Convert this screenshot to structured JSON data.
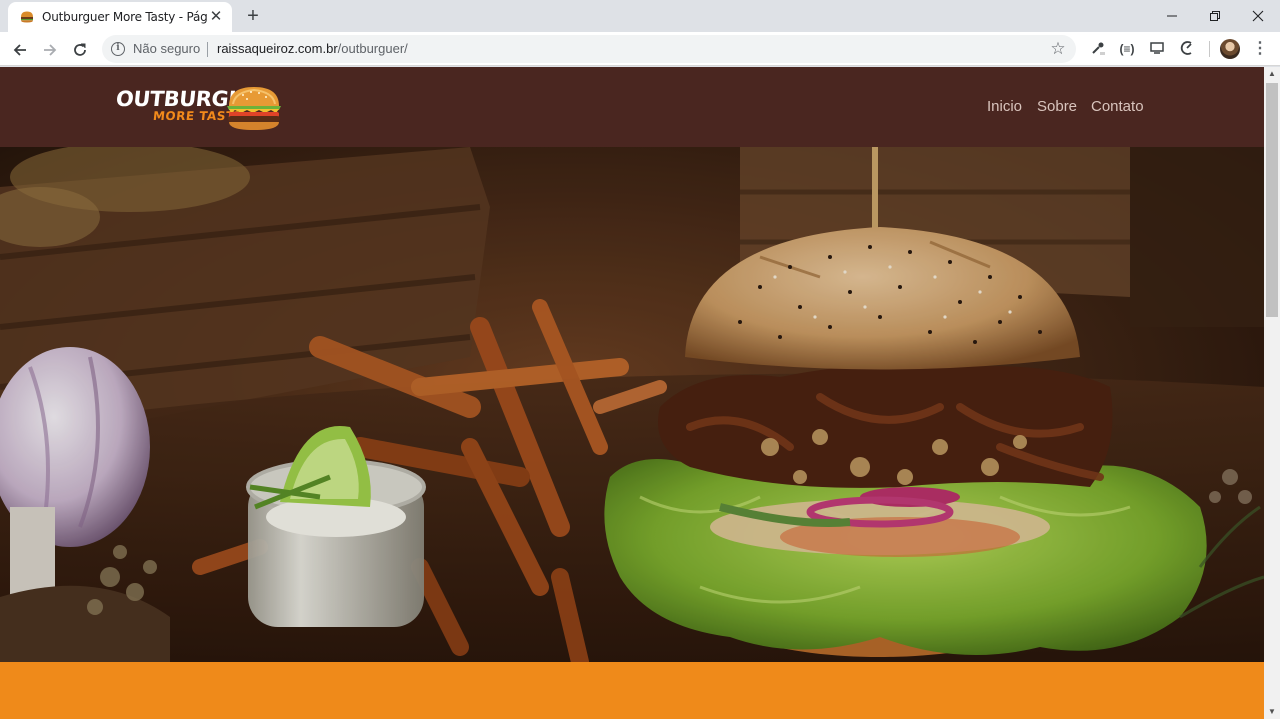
{
  "browser": {
    "tab_title": "Outburguer More Tasty - Página",
    "close_glyph": "✕",
    "new_tab_glyph": "+",
    "security_label": "Não seguro",
    "url_host": "raissaqueiroz.com.br",
    "url_path": "/outburguer/",
    "ext_labels": [
      "(≡)"
    ]
  },
  "site": {
    "logo": {
      "line1": "OUTBURGUER",
      "line2": "MORE TASTY"
    },
    "nav": [
      "Inicio",
      "Sobre",
      "Contato"
    ],
    "colors": {
      "header_bg": "#4a2620",
      "accent": "#ef8a1a",
      "nav_text": "#d9c4bd"
    }
  },
  "icons": {
    "back": "back-arrow-icon",
    "forward": "forward-arrow-icon",
    "reload": "reload-icon",
    "info": "info-icon",
    "star": "star-icon",
    "menu": "kebab-menu-icon"
  }
}
